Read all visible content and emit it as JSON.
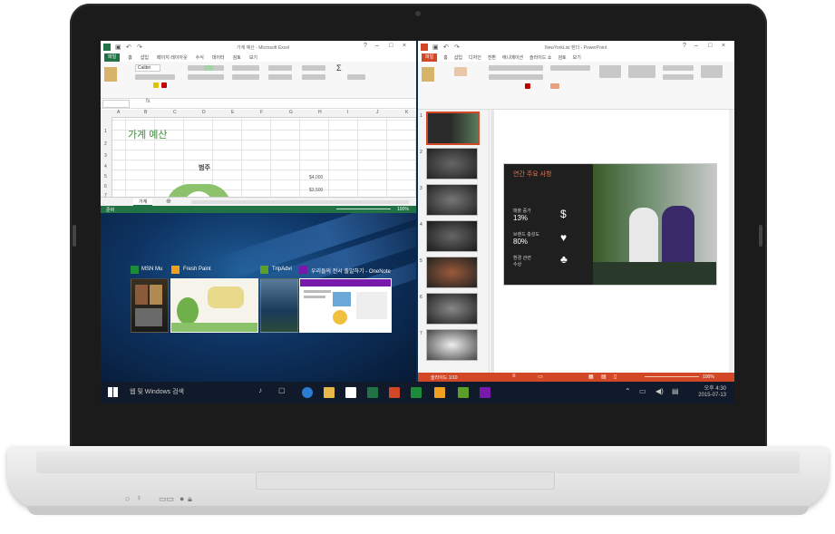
{
  "excel": {
    "title": "가계 예산 - Microsoft Excel",
    "tabs": [
      "파일",
      "홈",
      "삽입",
      "페이지 레이아웃",
      "수식",
      "데이터",
      "검토",
      "보기"
    ],
    "font_name": "Calibri",
    "sheet_title": "가계 예산",
    "chart_title": "범주",
    "value_labels": [
      "$4,000",
      "$3,500"
    ],
    "sheet_tab": "가계",
    "status_left": "준비",
    "zoom": "100%",
    "columns": [
      "A",
      "B",
      "C",
      "D",
      "E",
      "F",
      "G",
      "H",
      "I",
      "J",
      "K"
    ],
    "rows": [
      "1",
      "2",
      "3",
      "4",
      "5",
      "6",
      "7"
    ]
  },
  "desktop": {
    "task_view_labels": [
      "MSN Mu",
      "Fresh Paint",
      "TripAdvi",
      "우리들의 전시 출발하기 - OneNote"
    ]
  },
  "ppt": {
    "title": "NewYorkList 렌더 - PowerPoint",
    "tabs": [
      "파일",
      "홈",
      "삽입",
      "디자인",
      "전환",
      "애니메이션",
      "슬라이드 쇼",
      "검토",
      "보기"
    ],
    "slide_numbers": [
      "1",
      "2",
      "3",
      "4",
      "5",
      "6",
      "7"
    ],
    "slide_title": "연간 주요 사항",
    "stats": [
      {
        "label": "매출 증가",
        "value": "13%"
      },
      {
        "label": "브랜드 충성도",
        "value": "80%"
      },
      {
        "label": "환경 관련",
        "value": "수상"
      }
    ],
    "status_left": "슬라이드 1/10",
    "zoom": "100%"
  },
  "taskbar": {
    "search_placeholder": "웹 및 Windows 검색",
    "time": "오후 4:30",
    "date": "2015-07-13"
  },
  "colors": {
    "excel_green": "#217346",
    "ppt_orange": "#d24726",
    "onenote_purple": "#7719aa",
    "edge_blue": "#2b7cd3"
  }
}
